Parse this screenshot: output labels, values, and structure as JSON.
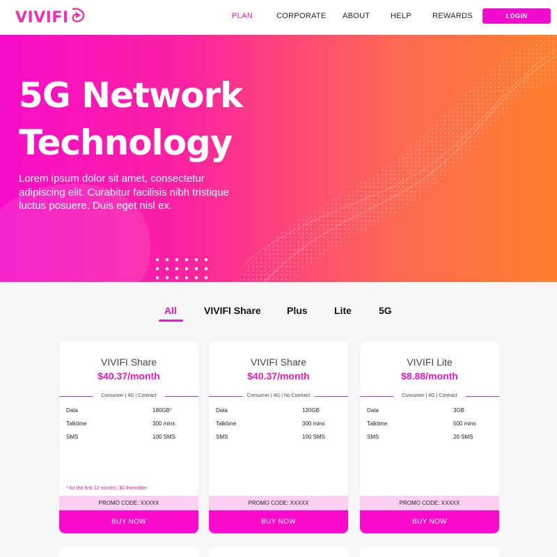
{
  "header": {
    "logo_text": "VIVIFI",
    "nav": [
      "PLAN",
      "CORPORATE",
      "ABOUT",
      "HELP",
      "REWARDS"
    ],
    "login_label": "LOGIN"
  },
  "hero": {
    "title_line1": "5G Network",
    "title_line2": "Technology",
    "description": "Lorem ipsum dolor sit amet, consectetur adipiscing elit. Curabitur facilisis nibh tristique luctus posuere. Duis eget nisl ex."
  },
  "tabs": {
    "items": [
      "All",
      "VIVIFI Share",
      "Plus",
      "Lite",
      "5G"
    ],
    "active": "All"
  },
  "plans": [
    {
      "name": "VIVIFI Share",
      "price": "$40.37/month",
      "tag": "Consumer | 4G | Contract",
      "specs": [
        {
          "label": "Data",
          "value": "180GB",
          "star": "*"
        },
        {
          "label": "Talktime",
          "value": "300 mins",
          "star": ""
        },
        {
          "label": "SMS",
          "value": "100 SMS",
          "star": ""
        }
      ],
      "footnote": "*  for the first 12 months; $0 thereafter",
      "promo": "PROMO CODE: XXXXX",
      "buy_label": "BUY NOW"
    },
    {
      "name": "VIVIFI Share",
      "price": "$40.37/month",
      "tag": "Consumer | 4G | No Contract",
      "specs": [
        {
          "label": "Data",
          "value": "120GB",
          "star": ""
        },
        {
          "label": "Talktime",
          "value": "300 mins",
          "star": ""
        },
        {
          "label": "SMS",
          "value": "100 SMS",
          "star": ""
        }
      ],
      "footnote": "",
      "promo": "PROMO CODE: XXXXX",
      "buy_label": "BUY NOW"
    },
    {
      "name": "VIVIFI Lite",
      "price": "$8.88/month",
      "tag": "Consumer | 4G | Contract",
      "specs": [
        {
          "label": "Data",
          "value": "3GB",
          "star": ""
        },
        {
          "label": "Talktime",
          "value": "500 mins",
          "star": ""
        },
        {
          "label": "SMS",
          "value": "20 SMS",
          "star": ""
        }
      ],
      "footnote": "",
      "promo": "PROMO CODE: XXXXX",
      "buy_label": "BUY NOW"
    }
  ],
  "colors": {
    "brand_pink": "#e81ac3",
    "button_pink": "#fb0ccd",
    "promo_bg": "#fdd0f2",
    "hero_start": "#f70dc9",
    "hero_end": "#fe7f2b"
  }
}
